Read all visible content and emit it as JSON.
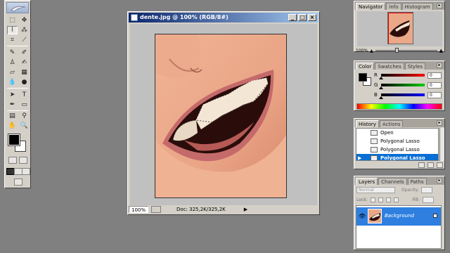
{
  "document": {
    "title": "dente.jpg @ 100% (RGB/8#)",
    "zoom": "100%",
    "doc_size": "Doc: 325,2K/325,2K"
  },
  "navigator": {
    "tabs": [
      "Navigator",
      "Info",
      "Histogram"
    ],
    "zoom": "100%"
  },
  "color": {
    "tabs": [
      "Color",
      "Swatches",
      "Styles"
    ],
    "channels": [
      {
        "label": "R",
        "value": "0",
        "color": "#e00000"
      },
      {
        "label": "G",
        "value": "0",
        "color": "#00a000"
      },
      {
        "label": "B",
        "value": "0",
        "color": "#0000e0"
      }
    ],
    "foreground": "#000000",
    "background": "#ffffff"
  },
  "history": {
    "tabs": [
      "History",
      "Actions"
    ],
    "items": [
      "Open",
      "Polygonal Lasso",
      "Polygonal Lasso",
      "Polygonal Lasso"
    ],
    "active_index": 3
  },
  "layers": {
    "tabs": [
      "Layers",
      "Channels",
      "Paths"
    ],
    "blend_mode": "Normal",
    "opacity_label": "Opacity:",
    "lock_label": "Lock:",
    "fill_label": "Fill:",
    "layer_name": "Background"
  },
  "accent": "#2e7fe0"
}
